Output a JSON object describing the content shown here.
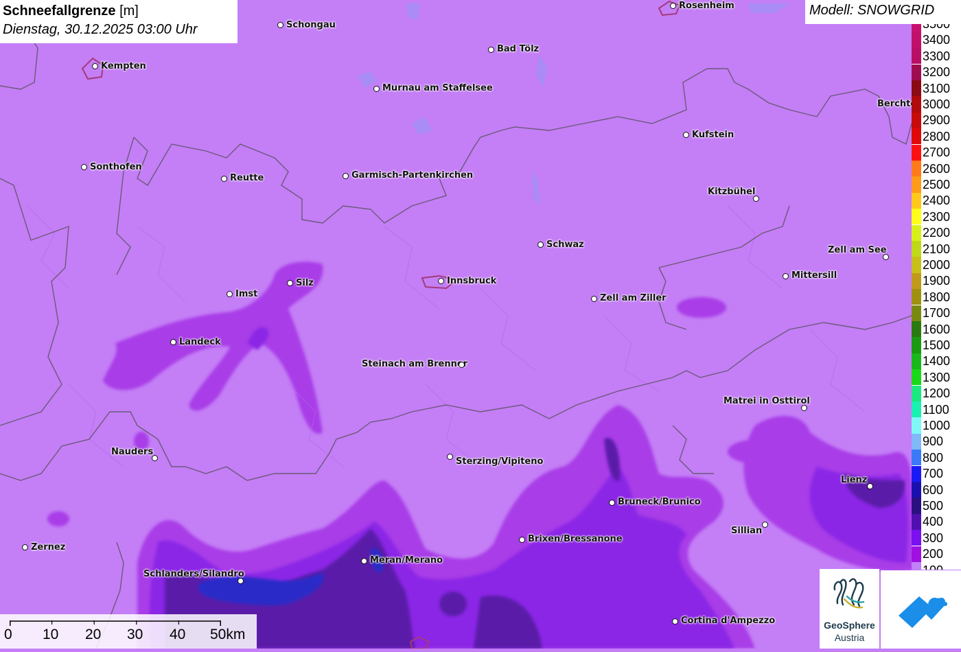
{
  "header": {
    "title_bold": "Schneefallgrenze",
    "title_unit": "[m]",
    "subtitle": "Dienstag, 30.12.2025 03:00 Uhr"
  },
  "model_label": "Modell: SNOWGRID",
  "legend": {
    "entries": [
      {
        "label": "3500",
        "color": "#c8106e"
      },
      {
        "label": "3400",
        "color": "#c0106a"
      },
      {
        "label": "3300",
        "color": "#b80e66"
      },
      {
        "label": "3200",
        "color": "#a00c50"
      },
      {
        "label": "3100",
        "color": "#8c0a14"
      },
      {
        "label": "3000",
        "color": "#b00a0a"
      },
      {
        "label": "2900",
        "color": "#c80a0a"
      },
      {
        "label": "2800",
        "color": "#e00808"
      },
      {
        "label": "2700",
        "color": "#ff1010"
      },
      {
        "label": "2600",
        "color": "#ff7a1a"
      },
      {
        "label": "2500",
        "color": "#ff9a1a"
      },
      {
        "label": "2400",
        "color": "#ffc81a"
      },
      {
        "label": "2300",
        "color": "#ffff1a"
      },
      {
        "label": "2200",
        "color": "#d8f01a"
      },
      {
        "label": "2100",
        "color": "#c0d81a"
      },
      {
        "label": "2000",
        "color": "#c8c01a"
      },
      {
        "label": "1900",
        "color": "#c09a1a"
      },
      {
        "label": "1800",
        "color": "#a09010"
      },
      {
        "label": "1700",
        "color": "#7a8a10"
      },
      {
        "label": "1600",
        "color": "#2a7a10"
      },
      {
        "label": "1500",
        "color": "#1a9a10"
      },
      {
        "label": "1400",
        "color": "#1ab81a"
      },
      {
        "label": "1300",
        "color": "#1ad81a"
      },
      {
        "label": "1200",
        "color": "#1ae880"
      },
      {
        "label": "1100",
        "color": "#1af0b0"
      },
      {
        "label": "1000",
        "color": "#80f8f8"
      },
      {
        "label": "900",
        "color": "#80b8f8"
      },
      {
        "label": "800",
        "color": "#3a7af8"
      },
      {
        "label": "700",
        "color": "#1a1af8"
      },
      {
        "label": "600",
        "color": "#1a10b0"
      },
      {
        "label": "500",
        "color": "#2a1080"
      },
      {
        "label": "400",
        "color": "#5010b0"
      },
      {
        "label": "300",
        "color": "#7a10f0"
      },
      {
        "label": "200",
        "color": "#a010e0"
      },
      {
        "label": "100",
        "color": "#c080f8"
      }
    ]
  },
  "cities": [
    {
      "name": "Rosenheim"
    },
    {
      "name": "Schongau"
    },
    {
      "name": "Kempten"
    },
    {
      "name": "Bad Tölz"
    },
    {
      "name": "Murnau am Staffelsee"
    },
    {
      "name": "Berchte"
    },
    {
      "name": "Kufstein"
    },
    {
      "name": "Sonthofen"
    },
    {
      "name": "Reutte"
    },
    {
      "name": "Garmisch-Partenkirchen"
    },
    {
      "name": "Kitzbühel"
    },
    {
      "name": "Schwaz"
    },
    {
      "name": "Zell am See"
    },
    {
      "name": "Mittersill"
    },
    {
      "name": "Silz"
    },
    {
      "name": "Innsbruck"
    },
    {
      "name": "Imst"
    },
    {
      "name": "Zell am Ziller"
    },
    {
      "name": "Landeck"
    },
    {
      "name": "Steinach am Brenner"
    },
    {
      "name": "Matrei in Osttirol"
    },
    {
      "name": "Nauders"
    },
    {
      "name": "Sterzing/Vipiteno"
    },
    {
      "name": "Lienz"
    },
    {
      "name": "Bruneck/Brunico"
    },
    {
      "name": "Sillian"
    },
    {
      "name": "Brixen/Bressanone"
    },
    {
      "name": "Zernez"
    },
    {
      "name": "Meran/Merano"
    },
    {
      "name": "Schlanders/Silandro"
    },
    {
      "name": "Cortina d'Ampezzo"
    }
  ],
  "scale": {
    "labels": [
      "0",
      "10",
      "20",
      "30",
      "40",
      "50km"
    ]
  },
  "logos": {
    "geosphere_title": "GeoSphere",
    "geosphere_sub": "Austria"
  }
}
